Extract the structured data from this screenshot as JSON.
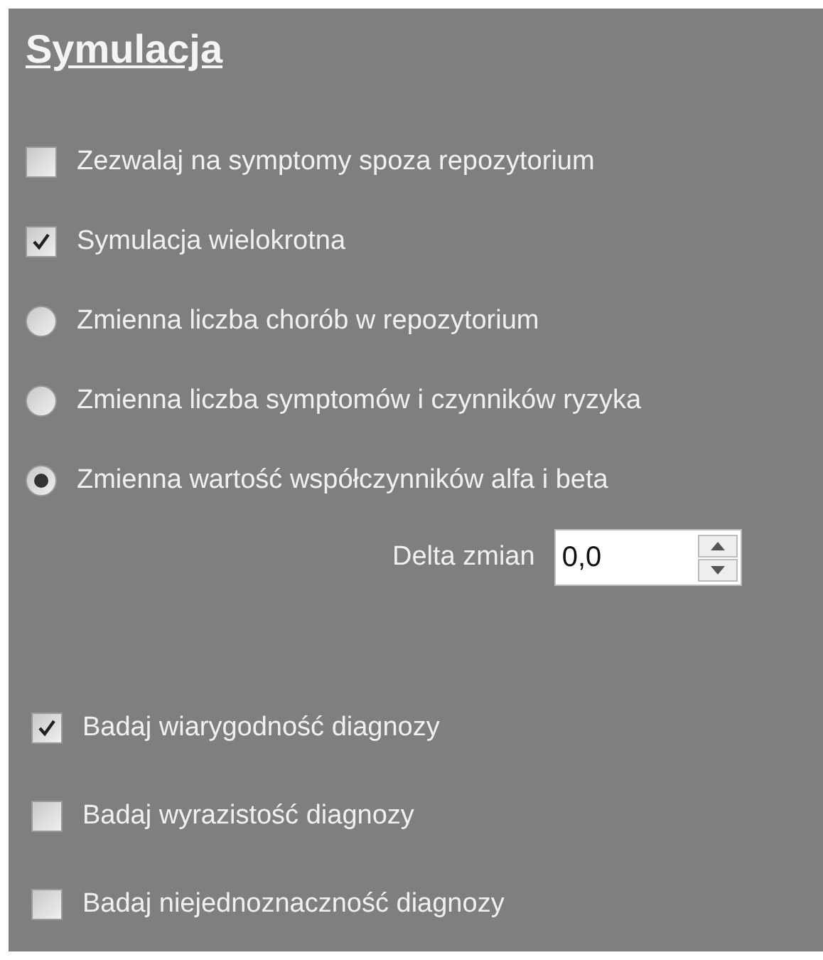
{
  "title": "Symulacja",
  "options": [
    {
      "kind": "checkbox",
      "label": "Zezwalaj na symptomy spoza repozytorium",
      "checked": false
    },
    {
      "kind": "checkbox",
      "label": "Symulacja wielokrotna",
      "checked": true
    },
    {
      "kind": "radio",
      "label": "Zmienna liczba chorób w repozytorium",
      "selected": false
    },
    {
      "kind": "radio",
      "label": "Zmienna liczba symptomów i czynników ryzyka",
      "selected": false
    },
    {
      "kind": "radio",
      "label": "Zmienna wartość współczynników alfa i beta",
      "selected": true
    }
  ],
  "delta": {
    "label": "Delta zmian",
    "value": "0,0"
  },
  "studies": [
    {
      "label": "Badaj wiarygodność diagnozy",
      "checked": true
    },
    {
      "label": "Badaj wyrazistość diagnozy",
      "checked": false
    },
    {
      "label": "Badaj niejednoznaczność diagnozy",
      "checked": false
    }
  ]
}
